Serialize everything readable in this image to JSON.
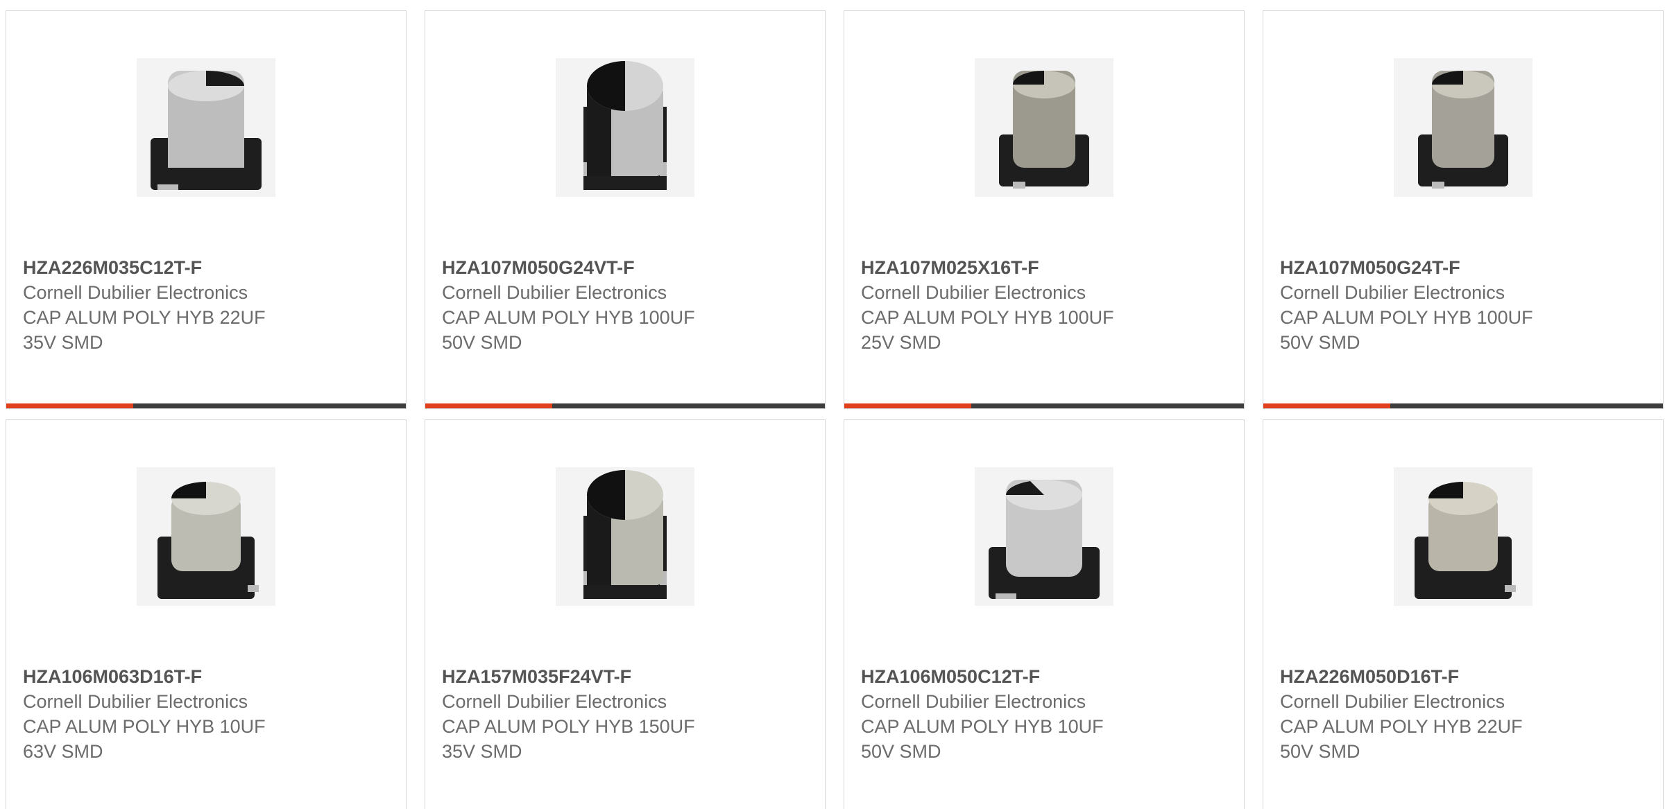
{
  "colors": {
    "accent": "#e0401c",
    "bar": "#3d3d3d",
    "text": "#6b6b6b",
    "border": "#d6d6d6"
  },
  "products": [
    {
      "part_number": "HZA226M035C12T-F",
      "manufacturer": "Cornell Dubilier Electronics",
      "description_line1": "CAP ALUM POLY HYB 22UF",
      "description_line2": "35V SMD"
    },
    {
      "part_number": "HZA107M050G24VT-F",
      "manufacturer": "Cornell Dubilier Electronics",
      "description_line1": "CAP ALUM POLY HYB 100UF",
      "description_line2": "50V SMD"
    },
    {
      "part_number": "HZA107M025X16T-F",
      "manufacturer": "Cornell Dubilier Electronics",
      "description_line1": "CAP ALUM POLY HYB 100UF",
      "description_line2": "25V SMD"
    },
    {
      "part_number": "HZA107M050G24T-F",
      "manufacturer": "Cornell Dubilier Electronics",
      "description_line1": "CAP ALUM POLY HYB 100UF",
      "description_line2": "50V SMD"
    },
    {
      "part_number": "HZA106M063D16T-F",
      "manufacturer": "Cornell Dubilier Electronics",
      "description_line1": "CAP ALUM POLY HYB 10UF",
      "description_line2": "63V SMD"
    },
    {
      "part_number": "HZA157M035F24VT-F",
      "manufacturer": "Cornell Dubilier Electronics",
      "description_line1": "CAP ALUM POLY HYB 150UF",
      "description_line2": "35V SMD"
    },
    {
      "part_number": "HZA106M050C12T-F",
      "manufacturer": "Cornell Dubilier Electronics",
      "description_line1": "CAP ALUM POLY HYB 10UF",
      "description_line2": "50V SMD"
    },
    {
      "part_number": "HZA226M050D16T-F",
      "manufacturer": "Cornell Dubilier Electronics",
      "description_line1": "CAP ALUM POLY HYB 22UF",
      "description_line2": "50V SMD"
    }
  ]
}
